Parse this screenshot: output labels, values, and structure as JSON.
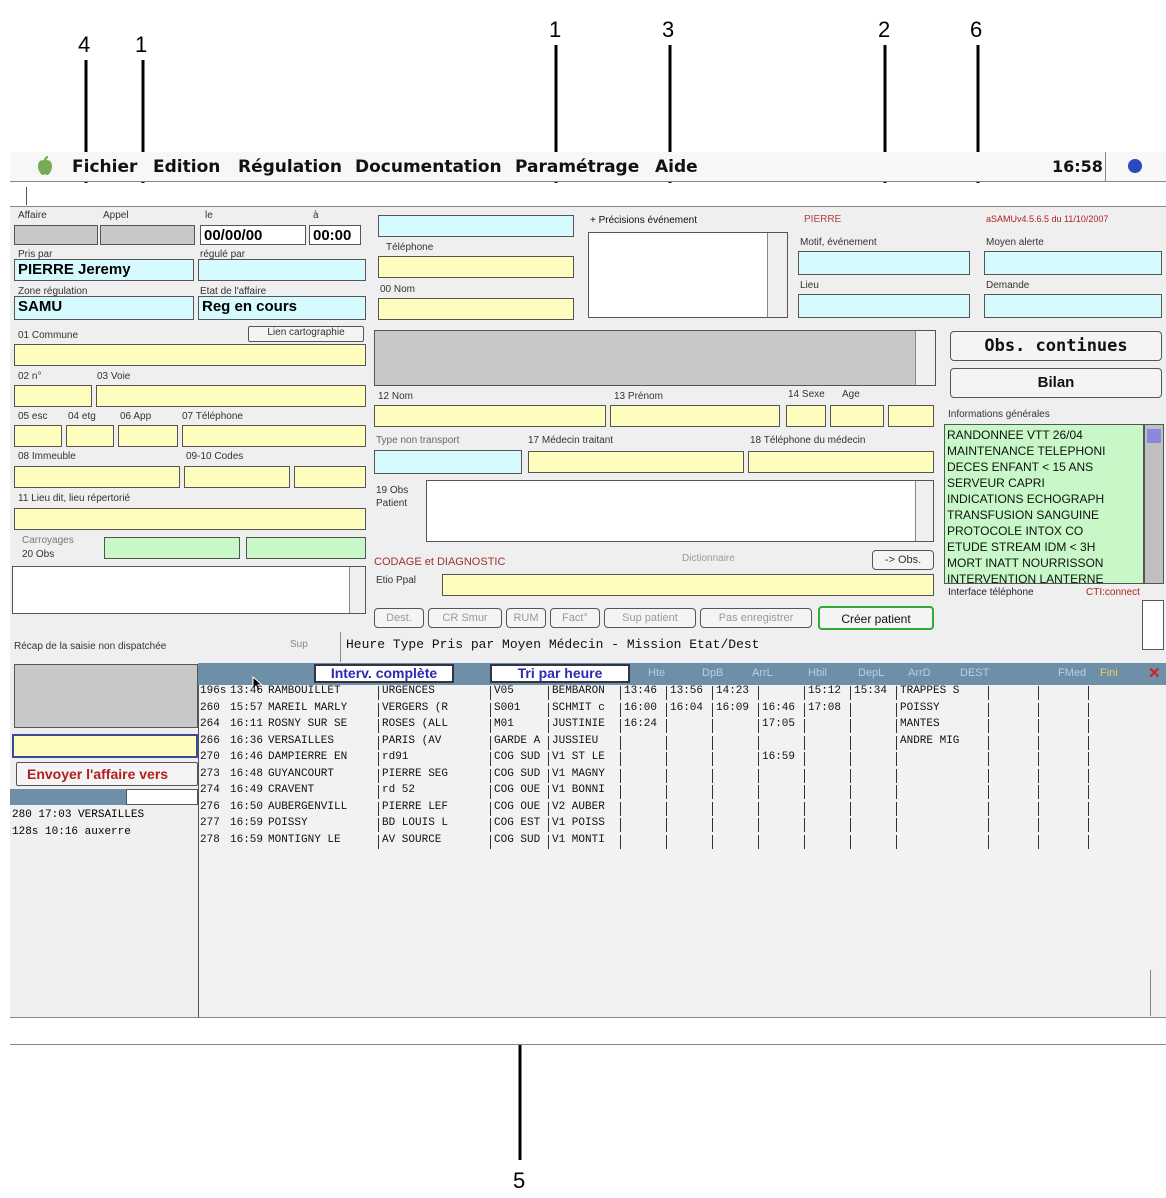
{
  "annotations": [
    "4",
    "1",
    "1",
    "3",
    "2",
    "6",
    "5"
  ],
  "menubar": {
    "items": [
      "Fichier",
      "Edition",
      "Régulation",
      "Documentation",
      "Paramétrage",
      "Aide"
    ],
    "clock": "16:58"
  },
  "left": {
    "affaire_label": "Affaire",
    "appel_label": "Appel",
    "le_label": "le",
    "a_label": "à",
    "date_value": "00/00/00",
    "time_value": "00:00",
    "pris_par_label": "Pris par",
    "pris_par_value": "PIERRE Jeremy",
    "regule_par_label": "régulé par",
    "zone_label": "Zone régulation",
    "zone_value": "SAMU",
    "etat_label": "Etat de l'affaire",
    "etat_value": "Reg en cours",
    "commune_label": "01 Commune",
    "lien_carto": "Lien cartographie",
    "no_label": "02 n°",
    "voie_label": "03 Voie",
    "esc_label": "05 esc",
    "etg_label": "04 etg",
    "app_label": "06 App",
    "tel_label": "07 Téléphone",
    "immeuble_label": "08 Immeuble",
    "codes_label": "09-10 Codes",
    "lieu_dit_label": "11 Lieu dit, lieu répertorié",
    "carroyages_label": "Carroyages",
    "obs_label": "20 Obs"
  },
  "middle": {
    "telephone_label": "Téléphone",
    "nom00_label": "00 Nom",
    "precisions_label": "+ Précisions événement",
    "nom12_label": "12 Nom",
    "prenom_label": "13 Prénom",
    "sexe_label": "14 Sexe",
    "age_label": "Age",
    "type_non_transport_label": "Type non transport",
    "medecin_label": "17 Médecin traitant",
    "tel_medecin_label": "18 Téléphone du médecin",
    "obs19_label": "19 Obs Patient",
    "codage_label": "CODAGE et DIAGNOSTIC",
    "dictionnaire_label": "Dictionnaire",
    "obs_btn": "-> Obs.",
    "etio_label": "Etio Ppal",
    "buttons": [
      "Dest.",
      "CR Smur",
      "RUM",
      "Fact°",
      "Sup patient",
      "Pas enregistrer"
    ],
    "creer_patient": "Créer patient"
  },
  "right": {
    "user_name": "PIERRE",
    "version": "aSAMUv4.5.6.5 du 11/10/2007",
    "motif_label": "Motif, événement",
    "moyen_alerte_label": "Moyen alerte",
    "lieu_label": "Lieu",
    "demande_label": "Demande",
    "obs_continues": "Obs. continues",
    "bilan": "Bilan",
    "info_gen_label": "Informations générales",
    "info_items": [
      "RANDONNEE VTT 26/04",
      "MAINTENANCE TELEPHONI",
      "DECES ENFANT < 15 ANS",
      "SERVEUR CAPRI",
      "INDICATIONS ECHOGRAPH",
      "TRANSFUSION SANGUINE",
      "PROTOCOLE INTOX CO",
      "ETUDE STREAM IDM < 3H",
      "MORT INATT NOURRISSON",
      "INTERVENTION LANTERNE"
    ],
    "interface_label": "Interface téléphone",
    "cti_label": "CTI:connect"
  },
  "recap": {
    "label": "Récap de la saisie non dispatchée",
    "sup_label": "Sup",
    "columns": "Heure Type    Pris par   Moyen     Médecin - Mission  Etat/Dest",
    "envoyer": "Envoyer l'affaire vers",
    "rows": [
      {
        "num": "280",
        "time": "17:03",
        "place": "VERSAILLES"
      },
      {
        "num": "128s",
        "time": "10:16",
        "place": "auxerre"
      }
    ]
  },
  "grid": {
    "interv_btn": "Interv. complète",
    "tri_btn": "Tri par heure",
    "headers": [
      "Hte",
      "DpB",
      "ArrL",
      "Hbil",
      "DepL",
      "ArrD",
      "DEST",
      "FMed",
      "Fini"
    ],
    "rows": [
      {
        "id": "196s",
        "time": "13:46",
        "commune": "RAMBOUILLET",
        "adr": "URGENCES",
        "type": "V05",
        "moyen": "BEMBARON",
        "t1": "13:46",
        "t2": "13:56",
        "t3": "14:23",
        "t4": "",
        "t5": "15:12",
        "t6": "15:34",
        "dest": "TRAPPES S"
      },
      {
        "id": "260",
        "time": "15:57",
        "commune": "MAREIL MARLY",
        "adr": "VERGERS (R",
        "type": "S001",
        "moyen": "SCHMIT c",
        "t1": "16:00",
        "t2": "16:04",
        "t3": "16:09",
        "t4": "16:46",
        "t5": "17:08",
        "t6": "",
        "dest": "POISSY"
      },
      {
        "id": "264",
        "time": "16:11",
        "commune": "ROSNY SUR SE",
        "adr": "ROSES (ALL",
        "type": "M01",
        "moyen": "JUSTINIE",
        "t1": "16:24",
        "t2": "",
        "t3": "",
        "t4": "17:05",
        "t5": "",
        "t6": "",
        "dest": "MANTES"
      },
      {
        "id": "266",
        "time": "16:36",
        "commune": "VERSAILLES",
        "adr": "PARIS (AV",
        "type": "GARDE A",
        "moyen": "JUSSIEU",
        "t1": "",
        "t2": "",
        "t3": "",
        "t4": "",
        "t5": "",
        "t6": "",
        "dest": "ANDRE MIG"
      },
      {
        "id": "270",
        "time": "16:46",
        "commune": "DAMPIERRE EN",
        "adr": "rd91",
        "type": "COG SUD",
        "moyen": "V1 ST LE",
        "t1": "",
        "t2": "",
        "t3": "",
        "t4": "16:59",
        "t5": "",
        "t6": "",
        "dest": ""
      },
      {
        "id": "273",
        "time": "16:48",
        "commune": "GUYANCOURT",
        "adr": "PIERRE SEG",
        "type": "COG SUD",
        "moyen": "V1 MAGNY",
        "t1": "",
        "t2": "",
        "t3": "",
        "t4": "",
        "t5": "",
        "t6": "",
        "dest": ""
      },
      {
        "id": "274",
        "time": "16:49",
        "commune": "CRAVENT",
        "adr": "rd 52",
        "type": "COG OUE",
        "moyen": "V1 BONNI",
        "t1": "",
        "t2": "",
        "t3": "",
        "t4": "",
        "t5": "",
        "t6": "",
        "dest": ""
      },
      {
        "id": "276",
        "time": "16:50",
        "commune": "AUBERGENVILL",
        "adr": "PIERRE LEF",
        "type": "COG OUE",
        "moyen": "V2 AUBER",
        "t1": "",
        "t2": "",
        "t3": "",
        "t4": "",
        "t5": "",
        "t6": "",
        "dest": ""
      },
      {
        "id": "277",
        "time": "16:59",
        "commune": "POISSY",
        "adr": "BD LOUIS L",
        "type": "COG EST",
        "moyen": "V1 POISS",
        "t1": "",
        "t2": "",
        "t3": "",
        "t4": "",
        "t5": "",
        "t6": "",
        "dest": ""
      },
      {
        "id": "278",
        "time": "16:59",
        "commune": "MONTIGNY LE",
        "adr": "AV SOURCE",
        "type": "COG SUD",
        "moyen": "V1 MONTI",
        "t1": "",
        "t2": "",
        "t3": "",
        "t4": "",
        "t5": "",
        "t6": "",
        "dest": ""
      }
    ]
  }
}
